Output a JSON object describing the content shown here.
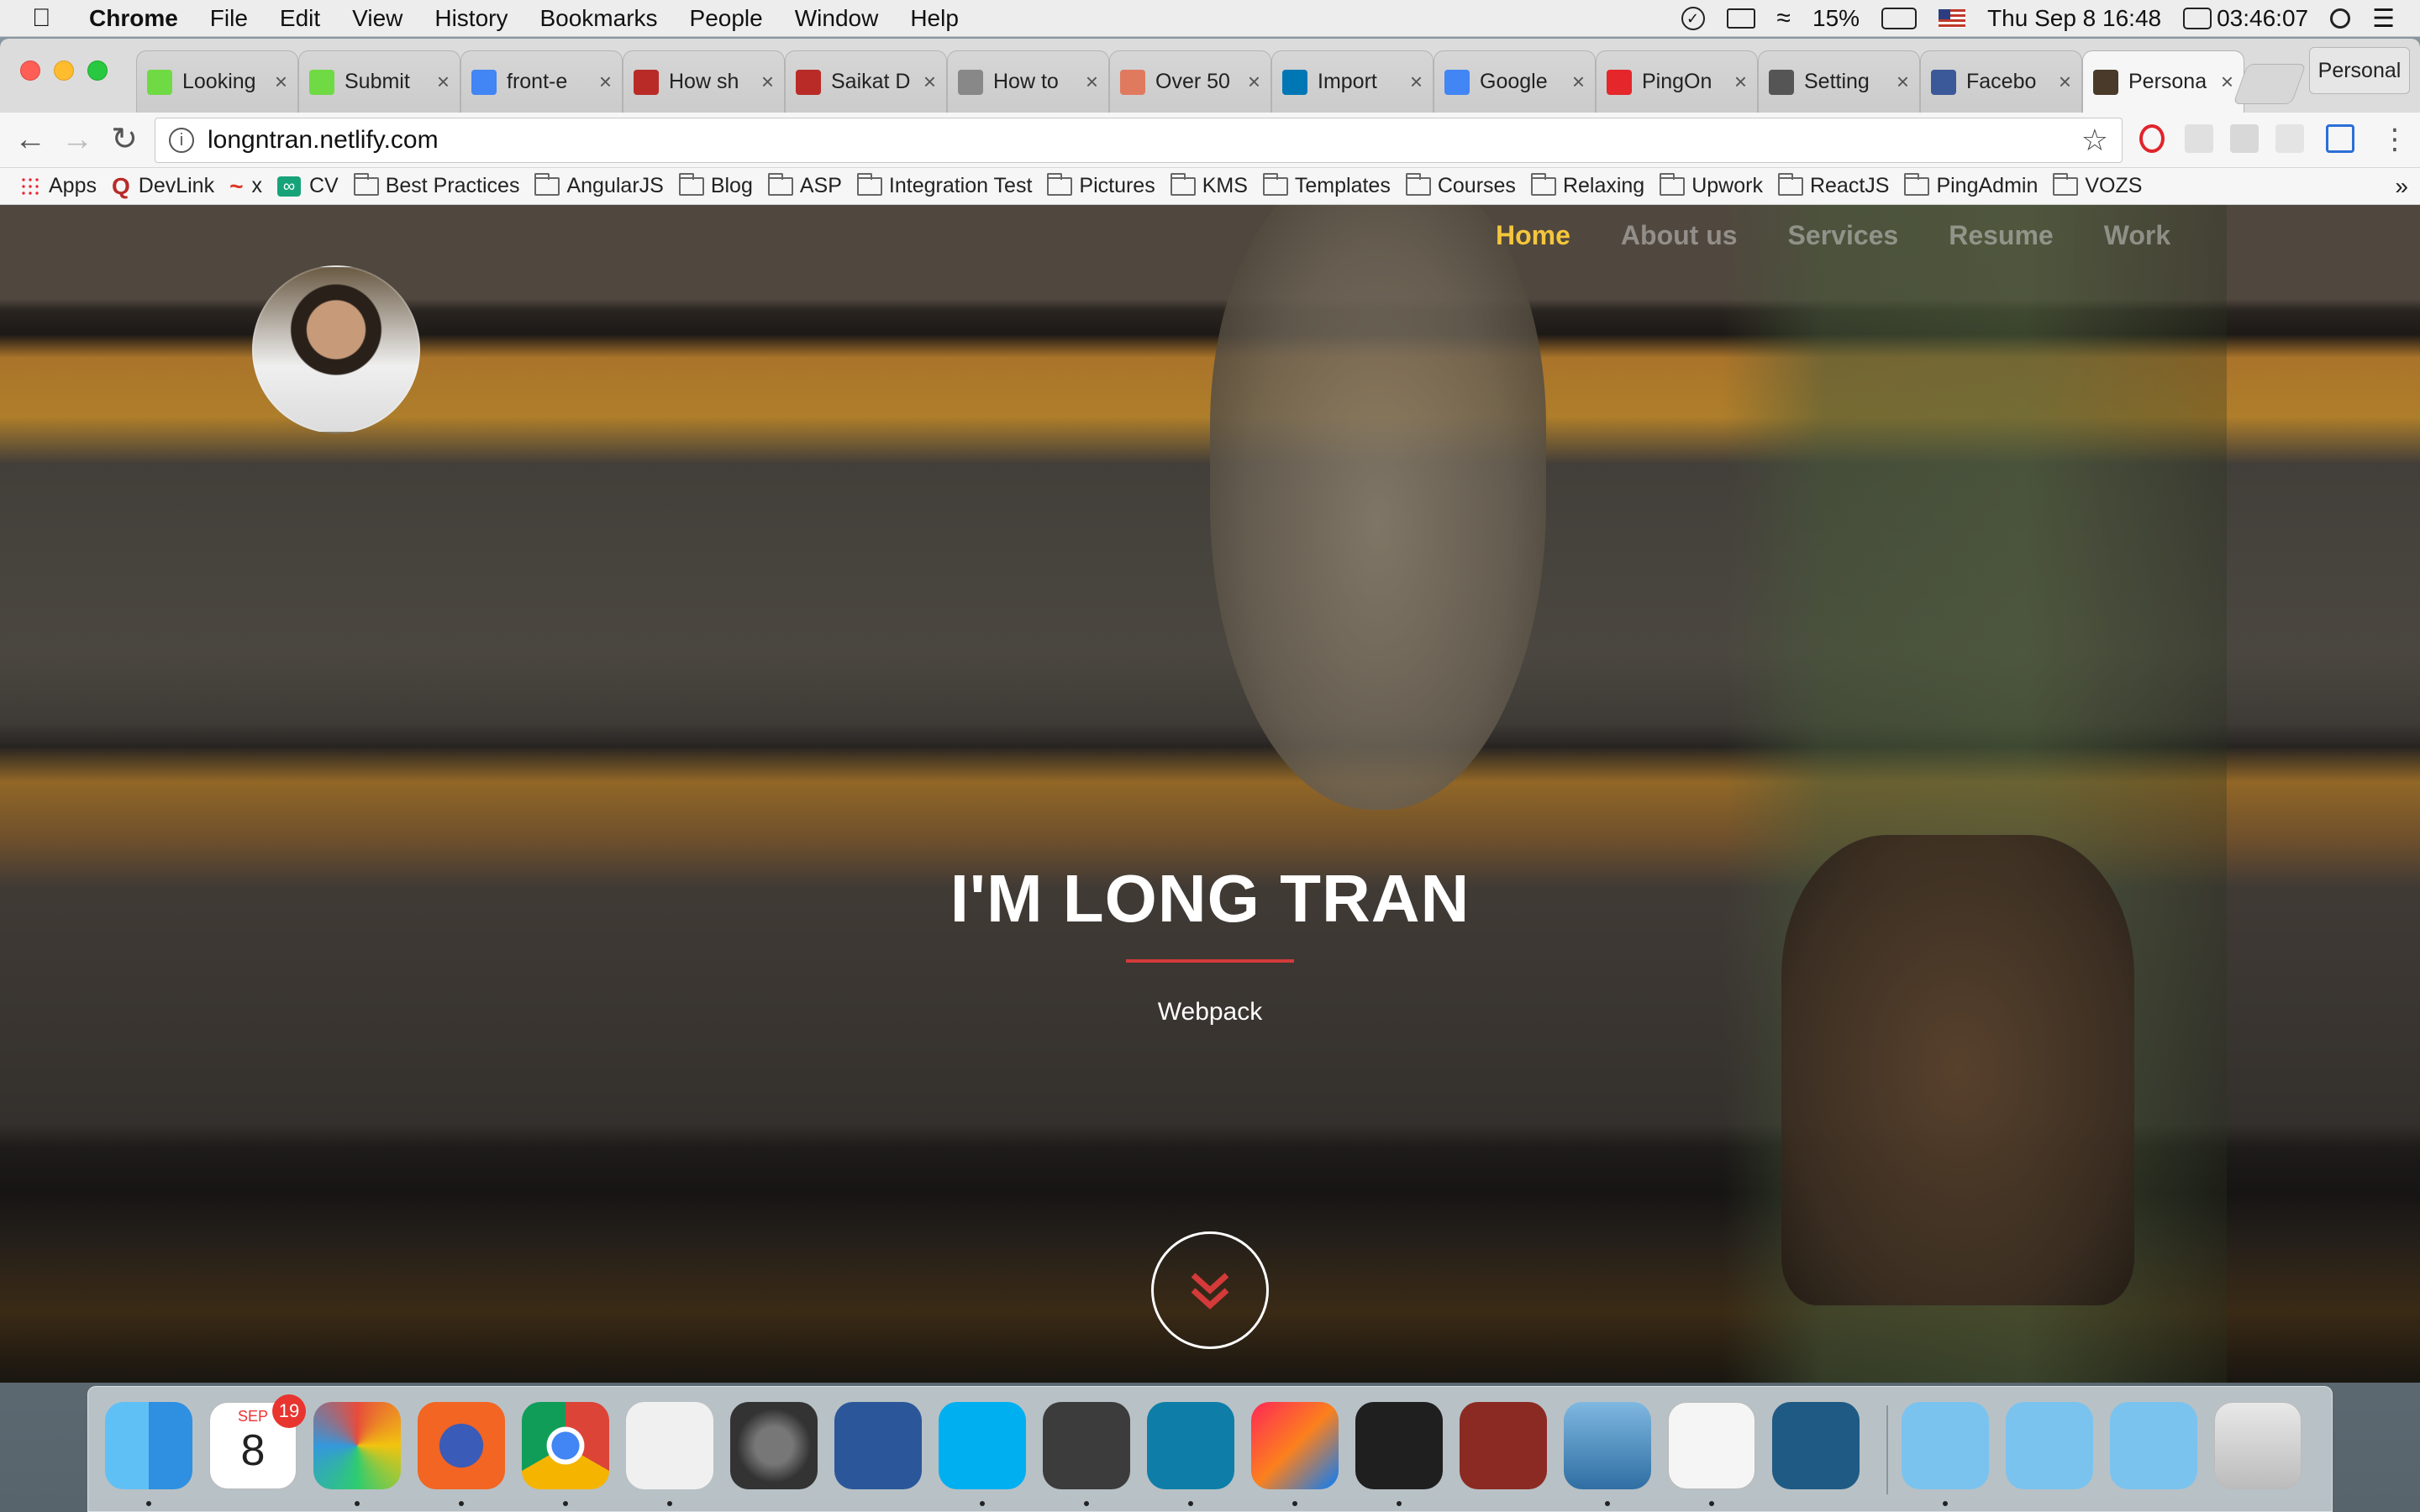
{
  "menubar": {
    "app_name": "Chrome",
    "menus": [
      "File",
      "Edit",
      "View",
      "History",
      "Bookmarks",
      "People",
      "Window",
      "Help"
    ],
    "battery": "15%",
    "datetime": "Thu Sep 8  16:48",
    "timer": "03:46:07"
  },
  "tabs": [
    {
      "title": "Looking",
      "icon": "upwork-icon",
      "color": "#6fda44"
    },
    {
      "title": "Submit",
      "icon": "upwork-icon",
      "color": "#6fda44"
    },
    {
      "title": "front-e",
      "icon": "google-icon",
      "color": "#4285f4"
    },
    {
      "title": "How sh",
      "icon": "quora-icon",
      "color": "#b92b27"
    },
    {
      "title": "Saikat D",
      "icon": "quora-icon",
      "color": "#b92b27"
    },
    {
      "title": "How to",
      "icon": "document-icon",
      "color": "#888888"
    },
    {
      "title": "Over 50",
      "icon": "document-icon",
      "color": "#e07a5f"
    },
    {
      "title": "Import",
      "icon": "linkedin-icon",
      "color": "#0077b5"
    },
    {
      "title": "Google",
      "icon": "google-translate-icon",
      "color": "#4285f4"
    },
    {
      "title": "PingOn",
      "icon": "pingone-icon",
      "color": "#e5262b"
    },
    {
      "title": "Setting",
      "icon": "gear-icon",
      "color": "#555555"
    },
    {
      "title": "Facebo",
      "icon": "facebook-icon",
      "color": "#3b5998"
    },
    {
      "title": "Persona",
      "icon": "avatar-icon",
      "color": "#4a3a2a",
      "active": true
    }
  ],
  "profile": "Personal",
  "url": "longntran.netlify.com",
  "bookmarks": [
    {
      "label": "Apps",
      "type": "apps"
    },
    {
      "label": "DevLink",
      "type": "quora"
    },
    {
      "label": "x",
      "type": "custom"
    },
    {
      "label": "CV",
      "type": "custom2"
    },
    {
      "label": "Best Practices",
      "type": "folder"
    },
    {
      "label": "AngularJS",
      "type": "folder"
    },
    {
      "label": "Blog",
      "type": "folder"
    },
    {
      "label": "ASP",
      "type": "folder"
    },
    {
      "label": "Integration Test",
      "type": "folder"
    },
    {
      "label": "Pictures",
      "type": "folder"
    },
    {
      "label": "KMS",
      "type": "folder"
    },
    {
      "label": "Templates",
      "type": "folder"
    },
    {
      "label": "Courses",
      "type": "folder"
    },
    {
      "label": "Relaxing",
      "type": "folder"
    },
    {
      "label": "Upwork",
      "type": "folder"
    },
    {
      "label": "ReactJS",
      "type": "folder"
    },
    {
      "label": "PingAdmin",
      "type": "folder"
    },
    {
      "label": "VOZS",
      "type": "folder"
    }
  ],
  "page": {
    "nav": [
      "Home",
      "About us",
      "Services",
      "Resume",
      "Work"
    ],
    "active_nav": "Home",
    "title": "I'M LONG TRAN",
    "subtitle": "Webpack",
    "accent": "#f5c63c",
    "line_color": "#d43a3a"
  },
  "dock": {
    "calendar_month": "SEP",
    "calendar_day": "8",
    "calendar_badge": "19",
    "apps": [
      "finder-icon",
      "calendar-icon",
      "photo-booth-icon",
      "firefox-icon",
      "chrome-icon",
      "slack-icon",
      "system-preferences-icon",
      "word-icon",
      "skype-icon",
      "sublime-text-icon",
      "dashlane-icon",
      "intellij-icon",
      "terminal-icon",
      "dictionary-icon",
      "preview-icon",
      "java-icon",
      "mysql-workbench-icon",
      "applications-folder-icon",
      "documents-folder-icon",
      "downloads-folder-icon",
      "trash-icon"
    ]
  }
}
